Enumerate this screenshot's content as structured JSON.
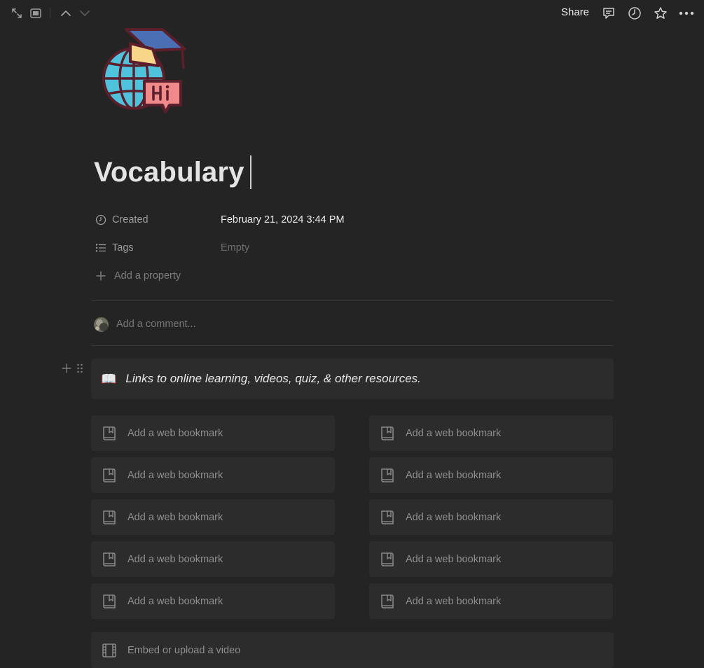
{
  "topbar": {
    "share_label": "Share",
    "icons": [
      "expand-icon",
      "sidebar-peek-icon",
      "chevron-up-icon",
      "chevron-down-icon",
      "comment-icon",
      "history-icon",
      "star-icon",
      "more-icon"
    ]
  },
  "page": {
    "title": "Vocabulary",
    "icon": "globe-graduation-hi-icon"
  },
  "properties": [
    {
      "name": "Created",
      "icon": "clock-icon",
      "value": "February 21, 2024 3:44 PM",
      "empty": false
    },
    {
      "name": "Tags",
      "icon": "list-icon",
      "value": "Empty",
      "empty": true
    }
  ],
  "add_property_label": "Add a property",
  "comment": {
    "placeholder": "Add a comment..."
  },
  "callout": {
    "emoji": "📖",
    "text": "Links to online learning, videos, quiz, & other resources."
  },
  "bookmarks": [
    {
      "label": "Add a web bookmark"
    },
    {
      "label": "Add a web bookmark"
    },
    {
      "label": "Add a web bookmark"
    },
    {
      "label": "Add a web bookmark"
    },
    {
      "label": "Add a web bookmark"
    },
    {
      "label": "Add a web bookmark"
    },
    {
      "label": "Add a web bookmark"
    },
    {
      "label": "Add a web bookmark"
    },
    {
      "label": "Add a web bookmark"
    },
    {
      "label": "Add a web bookmark"
    }
  ],
  "video": {
    "label": "Embed or upload a video"
  },
  "colors": {
    "background": "#242424",
    "block": "#2c2c2c",
    "title": "#e4e4e4",
    "muted": "#9b9b9b",
    "globe": "#4fc3dc",
    "cap": "#4a6fb5",
    "badge": "#f08a8a"
  }
}
